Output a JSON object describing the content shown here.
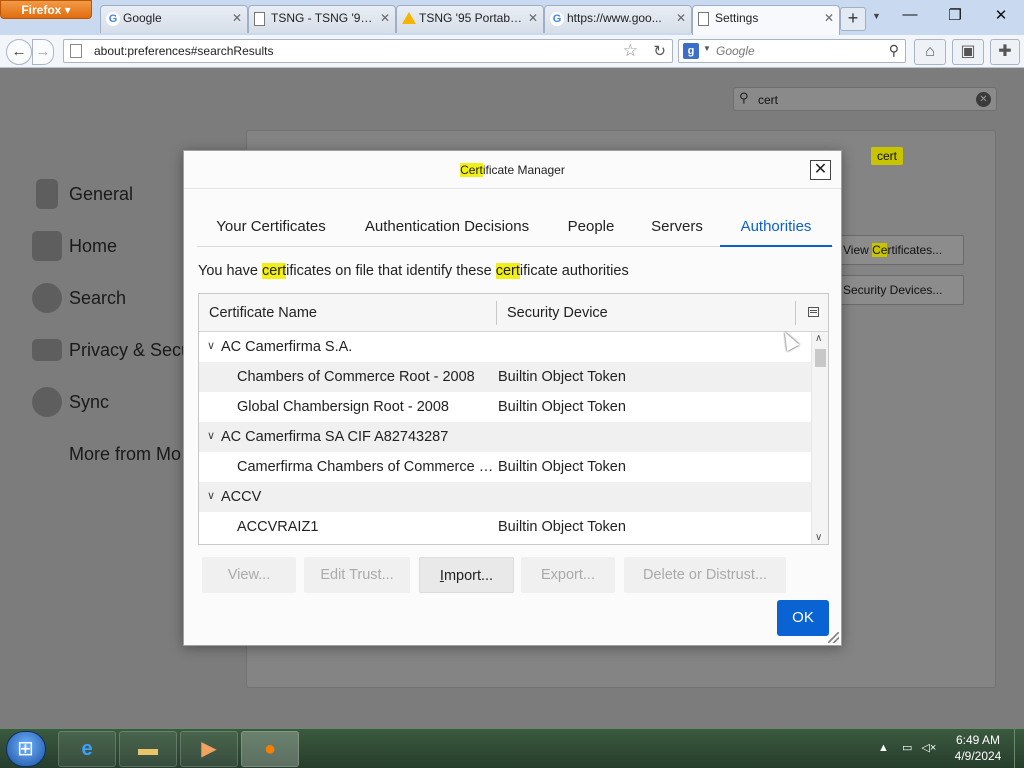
{
  "browser": {
    "app_button": "Firefox",
    "tabs": [
      {
        "label": "Google",
        "icon": "google-favicon"
      },
      {
        "label": "TSNG - TSNG '95 ...",
        "icon": "page-icon"
      },
      {
        "label": "TSNG '95 Portable...",
        "icon": "drive-favicon"
      },
      {
        "label": "https://www.goo...",
        "icon": "google-favicon"
      },
      {
        "label": "Settings",
        "icon": "page-icon"
      }
    ],
    "url": "about:preferences#searchResults",
    "search_engine_letter": "g",
    "search_placeholder": "Google"
  },
  "preferences": {
    "search_value": "cert",
    "categories": [
      "General",
      "Home",
      "Search",
      "Privacy & Secu",
      "Sync"
    ],
    "more_from": "More from Mo",
    "highlight_bubble": "cert",
    "buttons": {
      "view_certs_pre": "View ",
      "view_certs_hl": "Ce",
      "view_certs_post": "rtificates...",
      "security_devices": "Security Devices..."
    }
  },
  "dialog": {
    "title_hl": "Cert",
    "title_rest": "ificate Manager",
    "tabs": [
      "Your Certificates",
      "Authentication Decisions",
      "People",
      "Servers",
      "Authorities"
    ],
    "selected_tab": "Authorities",
    "description": {
      "p1": "You have ",
      "h1": "cert",
      "p2": "ificates on file that identify these ",
      "h2": "cert",
      "p3": "ificate authorities"
    },
    "columns": [
      "Certificate Name",
      "Security Device"
    ],
    "rows": [
      {
        "type": "group",
        "name": "AC Camerfirma S.A."
      },
      {
        "type": "cert",
        "name": "Chambers of Commerce Root - 2008",
        "device": "Builtin Object Token"
      },
      {
        "type": "cert",
        "name": "Global Chambersign Root - 2008",
        "device": "Builtin Object Token"
      },
      {
        "type": "group",
        "name": "AC Camerfirma SA CIF A82743287"
      },
      {
        "type": "cert",
        "name": "Camerfirma Chambers of Commerce Root",
        "device": "Builtin Object Token"
      },
      {
        "type": "group",
        "name": "ACCV"
      },
      {
        "type": "cert",
        "name": "ACCVRAIZ1",
        "device": "Builtin Object Token"
      }
    ],
    "buttons": {
      "view": "View...",
      "edit_trust": "Edit Trust...",
      "import": "Import...",
      "export": "Export...",
      "delete": "Delete or Distrust...",
      "ok": "OK"
    }
  },
  "taskbar": {
    "time": "6:49 AM",
    "date": "4/9/2024"
  },
  "colors": {
    "accent": "#0a61c9",
    "highlight": "#f2ee17",
    "ok_button": "#0a63d2"
  }
}
